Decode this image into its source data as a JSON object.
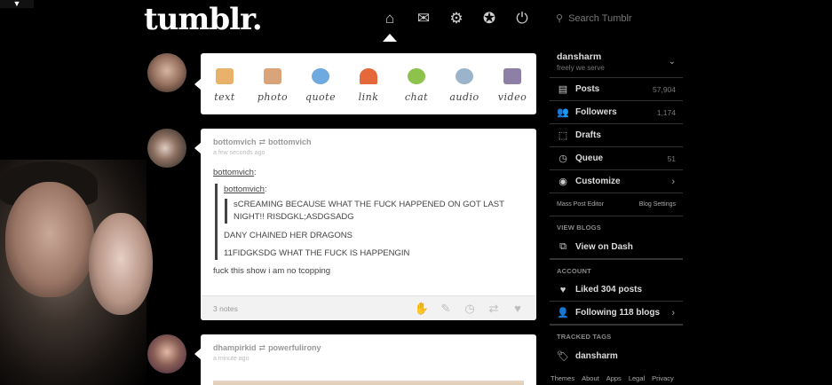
{
  "app": {
    "logo": "tumblr."
  },
  "nav": [
    {
      "name": "home-icon",
      "glyph": "⌂"
    },
    {
      "name": "inbox-icon",
      "glyph": "✉"
    },
    {
      "name": "settings-icon",
      "glyph": "⚙"
    },
    {
      "name": "activity-icon",
      "glyph": "✪"
    },
    {
      "name": "logout-icon",
      "glyph": "⏻"
    }
  ],
  "search": {
    "placeholder": "Search Tumblr"
  },
  "post_form": {
    "items": [
      {
        "label": "text",
        "color": "#e8b26a"
      },
      {
        "label": "photo",
        "color": "#d9a47a"
      },
      {
        "label": "quote",
        "color": "#6ea9e0"
      },
      {
        "label": "link",
        "color": "#e5683a"
      },
      {
        "label": "chat",
        "color": "#8dc24c"
      },
      {
        "label": "audio",
        "color": "#9bb4c9"
      },
      {
        "label": "video",
        "color": "#8e7fa6"
      }
    ]
  },
  "posts": [
    {
      "author": "bottomvich",
      "reblogged_from": "bottomvich",
      "time": "a few seconds ago",
      "lead": "bottomvich",
      "quote_author": "bottomvich",
      "quote_inner": "sCREAMING BECAUSE WHAT THE FUCK HAPPENED ON GOT LAST NIGHT!! RISDGKL;ASDGSADG",
      "quote_lines": [
        "DANY CHAINED HER DRAGONS",
        "11FIDGKSDG WHAT THE FUCK IS HAPPENGIN"
      ],
      "comment": "fuck this show i am no tcopping",
      "notes": "3 notes"
    },
    {
      "author": "dhampirkid",
      "reblogged_from": "powerfulirony",
      "time": "a minute ago"
    }
  ],
  "sidebar": {
    "blog_name": "dansharm",
    "blog_title": "freely we serve",
    "rows": [
      {
        "label": "Posts",
        "count": "57,904"
      },
      {
        "label": "Followers",
        "count": "1,174"
      },
      {
        "label": "Drafts",
        "count": ""
      },
      {
        "label": "Queue",
        "count": "51"
      },
      {
        "label": "Customize",
        "count": ""
      }
    ],
    "mass_post_editor": "Mass Post Editor",
    "blog_settings": "Blog Settings",
    "view_blogs_title": "VIEW BLOGS",
    "view_on_dash": "View on Dash",
    "account_title": "ACCOUNT",
    "liked": "Liked 304 posts",
    "following": "Following 118 blogs",
    "tracked_title": "TRACKED TAGS",
    "tracked_tag": "dansharm"
  },
  "footer": [
    "Themes",
    "About",
    "Apps",
    "Legal",
    "Privacy"
  ],
  "corner": "▼"
}
